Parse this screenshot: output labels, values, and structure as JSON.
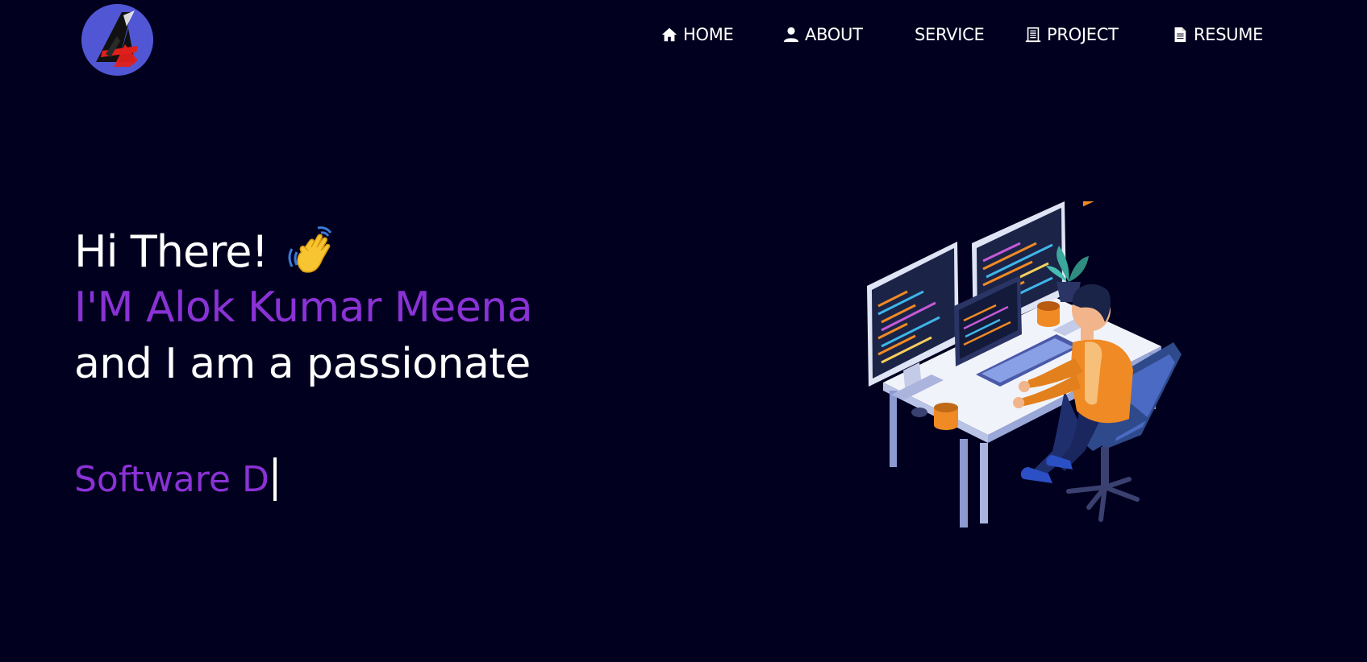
{
  "header": {
    "logo_letter": "A",
    "nav": [
      {
        "label": "HOME",
        "icon": "home-icon"
      },
      {
        "label": "ABOUT",
        "icon": "user-icon"
      },
      {
        "label": "SERVICE",
        "icon": ""
      },
      {
        "label": "PROJECT",
        "icon": "building-icon"
      },
      {
        "label": "RESUME",
        "icon": "document-icon"
      }
    ]
  },
  "hero": {
    "greeting": "Hi There!",
    "greeting_emoji": "waving-hand-icon",
    "name_line": "I'M Alok Kumar Meena",
    "intro_line": "and I am a passionate",
    "typed_text": "Software D"
  },
  "colors": {
    "background": "#02001f",
    "accent": "#8a32d6",
    "logo_bg": "#5157d4"
  },
  "illustration": "developer-at-desk-illustration"
}
